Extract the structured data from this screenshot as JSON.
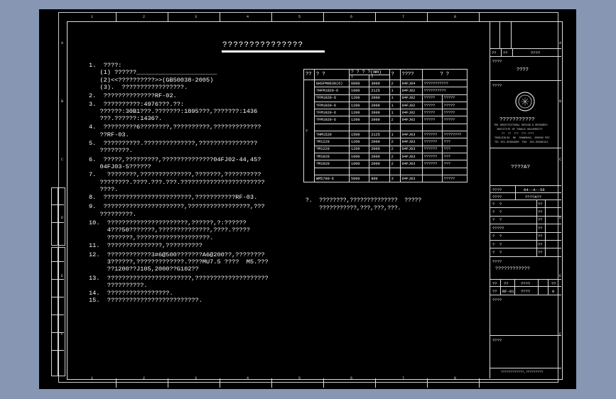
{
  "drawing": {
    "title": "???????????????",
    "notes": [
      [
        "1.  ????:"
      ],
      [
        "   (1) ??????______________________"
      ],
      [
        "   (2)<<??????????>>(GB50038-2005)"
      ],
      [
        "   (3).  ?????????????????."
      ],
      [
        "2.  ??????????????RF-02."
      ],
      [
        "3.  ??????????:4976???.??:",
        "   ??????:30B1???.???????:1895???,???????:1436",
        "   ???.??????:1436?."
      ],
      [
        "4.  ?????????6????????,??????????,?????????????",
        "   ??RF-03."
      ],
      [
        "5.  ??????????.??????????????,????????????????",
        "   ????????."
      ],
      [
        "6.  ?????,?????????,??????????????04FJ02-44,45?",
        "   04FJ03-5??????"
      ],
      [
        "7.   ????????,??????????????,???????,??????????",
        "   ????????.????.???.???.???????????????????????",
        "   ????."
      ],
      [
        "8.  ????????????????????????,???????????RF-03."
      ],
      [
        "9.  ??????????????????????,?????????????????,???",
        "   ?????????."
      ],
      [
        "10.  ??????????????????????,??????,?:??????",
        "     4???50???????,??????????????,????.?????",
        "     ???????,????????????????????."
      ],
      [
        "11.  ???????????????,??????????"
      ],
      [
        "12.  ????????????3#6@500???????A6@200??,????????",
        "     3??????,?????????????.????MU7.5 ????  M5.???",
        "     ??1200??J105,2000??G102??"
      ],
      [
        "13.  ???????????????????????,????????????????????",
        "     ??????????."
      ],
      [
        "14.  ?????????????????."
      ],
      [
        "15.  ?????????????????????????."
      ]
    ],
    "cabinet_table": {
      "headers": [
        "??",
        "?  ?",
        "?  ?  ?  ?(mm)",
        "?",
        "????",
        "?  ?"
      ],
      "subheaders": [
        "?",
        "?"
      ],
      "rows": [
        [
          "GHSFM0630(6)",
          "6000",
          "3000",
          "2",
          "04FJ04",
          "???????????"
        ],
        [
          "?HFM1020-6",
          "1000",
          "2125",
          "1",
          "04FJ02",
          "??????????"
        ],
        [
          "?FM1020-6",
          "1200",
          "2000",
          "1",
          "04FJ02",
          "?????",
          "?????"
        ],
        [
          "?FM1020-6",
          "1200",
          "2000",
          "1",
          "04FJ02",
          "?????",
          "?????"
        ],
        [
          "?FM1020-6",
          "1200",
          "2000",
          "1",
          "04FJ02",
          "?????",
          "?????"
        ],
        [
          "?FM1020-6",
          "1200",
          "2000",
          "2",
          "04FJ02",
          "?????",
          "?????"
        ],
        [
          "",
          "",
          "",
          "",
          "",
          "",
          ""
        ],
        [
          "?HM1520",
          "1500",
          "2125",
          "1",
          "04FJ03",
          "??????",
          "????????"
        ],
        [
          "?M1220",
          "1200",
          "2000",
          "2",
          "04FJ03",
          "??????",
          "???"
        ],
        [
          "?M1220",
          "1200",
          "2000",
          "2",
          "04FJ03",
          "??????",
          "???"
        ],
        [
          "?M1020",
          "1000",
          "2000",
          "2",
          "04FJ03",
          "??????",
          "???"
        ],
        [
          "?M1020",
          "1000",
          "2000",
          "2",
          "04FJ03",
          "??????",
          "???"
        ],
        [
          "",
          "",
          "",
          "",
          "",
          "",
          ""
        ],
        [
          "WM5700-6",
          "5000",
          "800",
          "3",
          "04FJ03",
          "",
          "?????"
        ]
      ],
      "group_label": "?"
    },
    "table_note": [
      "?.  ????????,??????????????  ?????",
      "    ???????????,???,???,???."
    ],
    "title_block": {
      "row1": [
        "??",
        "??",
        "????"
      ],
      "project_label": "????",
      "project_value": "????",
      "sheet_label": "????",
      "institute_cn": "???????????",
      "institute_en1": "THE ARCHITECTURAL DESIGN & RESEARCH",
      "institute_en2": "INSTITUTE OF TONGJI UNIVERSITY",
      "institute_en3": "??  ??  ???  ??? ????",
      "institute_en4": "TONGJIKLSU  NO  SHANGHAI, 200092 PRC",
      "institute_en5": "TEL 021-65981680  FAX  021-65985121",
      "drawing_name": "????A?",
      "date_label": "????",
      "date_value": "04--A--56",
      "sub_label": "????",
      "sub_value": "????A??",
      "sign_rows": [
        [
          "?  ?",
          "??"
        ],
        [
          "?  ?",
          "??"
        ],
        [
          "?  ?",
          "??"
        ],
        [
          "?????",
          "??"
        ],
        [
          "?  ?",
          "??"
        ],
        [
          "?  ?",
          "??"
        ],
        [
          "?  ?",
          "??"
        ]
      ],
      "drawing_title_label": "????",
      "drawing_title": "????????????",
      "number_row": [
        "??",
        "??",
        "????",
        "??"
      ],
      "number_values": [
        "??",
        "RF-01",
        "????",
        "0"
      ],
      "notes_label": "????",
      "bottom_label": "????",
      "bottom_footer": "????????????,?????????"
    },
    "border_numbers_top": [
      "1",
      "2",
      "3",
      "4",
      "5",
      "6",
      "7",
      "8"
    ],
    "border_numbers_bottom": [
      "1",
      "2",
      "3",
      "4",
      "5",
      "6",
      "7",
      "8"
    ],
    "border_letters": [
      "A",
      "B",
      "C",
      "D",
      "E",
      "F"
    ]
  },
  "colors": {
    "canvas": "#000000",
    "workspace": "#8796b3",
    "lines": "#dddddd",
    "text": "#ffffff"
  }
}
